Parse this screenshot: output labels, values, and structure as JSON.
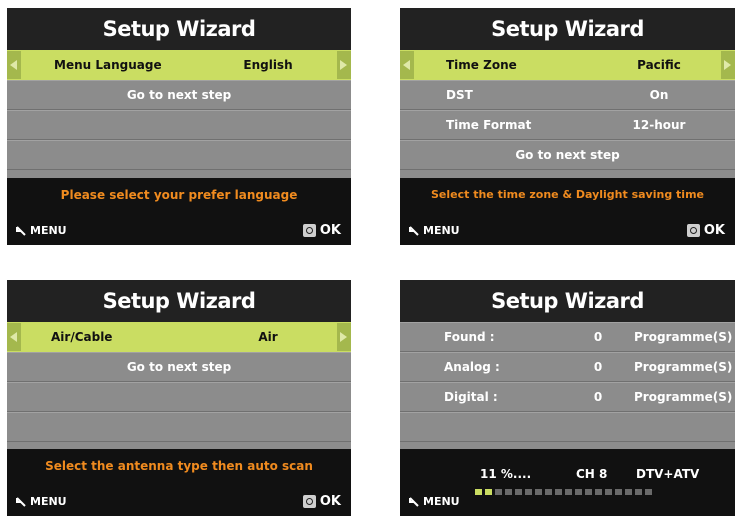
{
  "colors": {
    "highlight": "#cadd62",
    "message": "#f08b1f",
    "panel": "#8c8c8c",
    "dark": "#111111"
  },
  "screens": [
    {
      "title": "Setup Wizard",
      "selected": {
        "label": "Menu Language",
        "value": "English"
      },
      "next_step": "Go to next step",
      "message": "Please select your prefer language",
      "menu_label": "MENU",
      "ok_label": "OK"
    },
    {
      "title": "Setup Wizard",
      "selected": {
        "label": "Time Zone",
        "value": "Pacific"
      },
      "rows": [
        {
          "label": "DST",
          "value": "On"
        },
        {
          "label": "Time Format",
          "value": "12-hour"
        }
      ],
      "next_step": "Go to next step",
      "message": "Select the time zone & Daylight saving time",
      "menu_label": "MENU",
      "ok_label": "OK"
    },
    {
      "title": "Setup Wizard",
      "selected": {
        "label": "Air/Cable",
        "value": "Air"
      },
      "next_step": "Go to next step",
      "message": "Select the antenna type then auto scan",
      "menu_label": "MENU",
      "ok_label": "OK"
    },
    {
      "title": "Setup Wizard",
      "results": [
        {
          "label": "Found :",
          "count": "0",
          "unit": "Programme(S)"
        },
        {
          "label": "Analog :",
          "count": "0",
          "unit": "Programme(S)"
        },
        {
          "label": "Digital :",
          "count": "0",
          "unit": "Programme(S)"
        }
      ],
      "scan": {
        "percent": "11 %....",
        "channel": "CH 8",
        "mode": "DTV+ATV",
        "progress_fraction": 0.11
      },
      "menu_label": "MENU"
    }
  ]
}
